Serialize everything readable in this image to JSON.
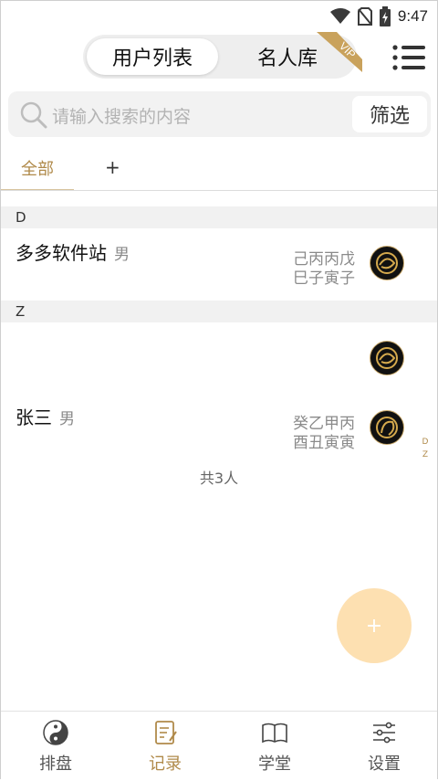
{
  "status_bar": {
    "time": "9:47"
  },
  "header": {
    "segment_active": "用户列表",
    "segment_inactive": "名人库",
    "vip_badge": "VIP"
  },
  "search": {
    "placeholder": "请输入搜索的内容",
    "filter_label": "筛选"
  },
  "tabs": {
    "all": "全部",
    "add": "+"
  },
  "sections": [
    {
      "letter": "D",
      "contacts": [
        {
          "name": "多多软件站",
          "gender": "男",
          "bazi_line1": "己丙丙戊",
          "bazi_line2": "巳子寅子"
        }
      ]
    },
    {
      "letter": "Z",
      "contacts": [
        {
          "name": "张三",
          "gender": "男",
          "bazi_line1": "癸乙甲丙",
          "bazi_line2": "酉丑寅寅"
        }
      ]
    }
  ],
  "index_bar": [
    "D",
    "Z"
  ],
  "total_text": "共3人",
  "fab_label": "+",
  "bottom_nav": [
    {
      "label": "排盘",
      "icon": "yin-yang-icon",
      "active": false
    },
    {
      "label": "记录",
      "icon": "notes-icon",
      "active": true
    },
    {
      "label": "学堂",
      "icon": "book-icon",
      "active": false
    },
    {
      "label": "设置",
      "icon": "sliders-icon",
      "active": false
    }
  ],
  "colors": {
    "accent": "#b08a4a",
    "fab": "#fde0b1",
    "section_bg": "#f1f1f1"
  }
}
